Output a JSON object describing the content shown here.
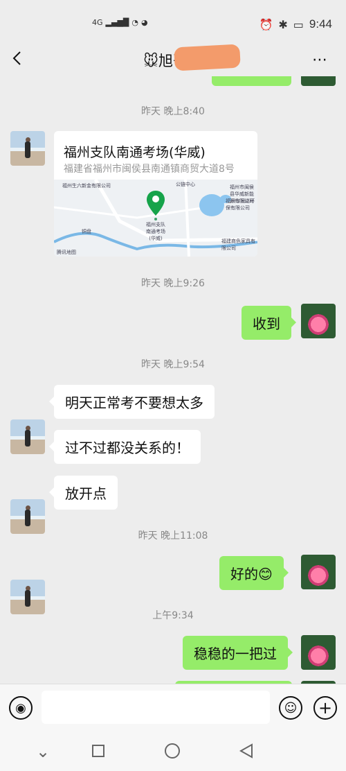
{
  "status_bar": {
    "network": "4G",
    "time": "9:44"
  },
  "header": {
    "title": "🐭旭哥🐭",
    "more": "⋯"
  },
  "messages": {
    "ts1": "昨天 晚上8:40",
    "location": {
      "name": "福州支队南通考场(华威)",
      "address": "福建省福州市闽侯县南通镇商贸大道8号",
      "map_pin_label": "福州支队南通考场(华威)",
      "map_provider": "腾讯地图"
    },
    "ts2": "昨天 晚上9:26",
    "m1": "收到",
    "ts3": "昨天 晚上9:54",
    "m2": "明天正常考不要想太多",
    "m3": "过不过都没关系的！",
    "m4": "放开点",
    "ts4": "昨天 晚上11:08",
    "m5": "好的😊",
    "ts5": "上午9:34",
    "m6": "稳稳的一把过"
  },
  "map_labels": {
    "a": "福州生六新金有限公司",
    "b": "公链中心",
    "c": "福州市闽侯县华威新能源有限公司",
    "d": "福州市润达环保有限公司",
    "e": "福建商色家具有限公司",
    "f": "铜盘"
  },
  "colors": {
    "bubble_green": "#95ec69",
    "background": "#ededed",
    "accent_scribble": "#f39b6b"
  }
}
